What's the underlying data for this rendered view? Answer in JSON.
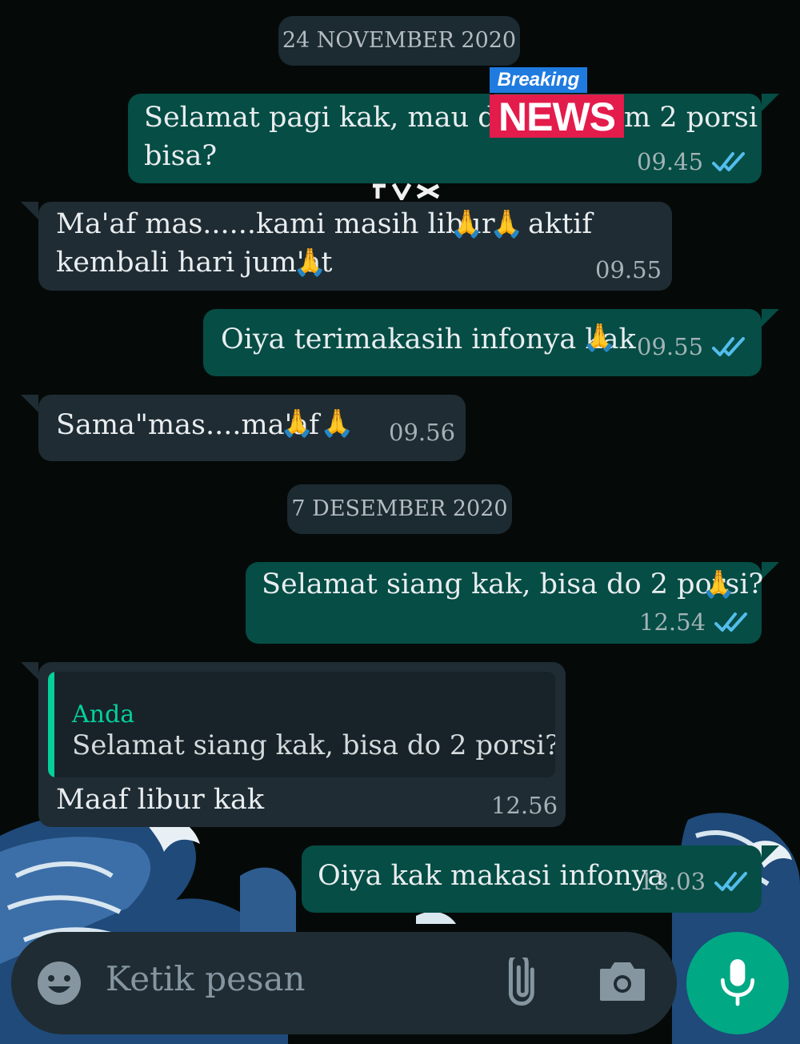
{
  "chat": {
    "date_1": "24 NOVEMBER 2020",
    "date_2": "7 DESEMBER 2020",
    "messages": [
      {
        "line1": "Selamat pagi kak, mau do m",
        "line1b": "m 2 porsi",
        "line2": "bisa?",
        "time": "09.45"
      },
      {
        "line1": "Ma'af mas......kami masih libur",
        "line1b": "aktif",
        "line2": "kembali hari jum'at",
        "time": "09.55"
      },
      {
        "text": "Oiya terimakasih infonya kak",
        "time": "09.55"
      },
      {
        "text": "Sama\"mas....ma'af",
        "time": "09.56"
      },
      {
        "text": "Selamat siang kak, bisa do 2 porsi?",
        "time": "12.54"
      },
      {
        "quote_name": "Anda",
        "quote_text": "Selamat siang kak, bisa do 2 porsi?",
        "text": "Maaf libur kak",
        "time": "12.56"
      },
      {
        "text": "Oiya kak makasi infonya",
        "time": "13.03"
      }
    ]
  },
  "overlay": {
    "breaking": "Breaking",
    "news": "NEWS"
  },
  "composer": {
    "placeholder": "Ketik pesan"
  },
  "icons": {
    "emoji": "emoji-icon",
    "attach": "paperclip-icon",
    "camera": "camera-icon",
    "mic": "mic-icon",
    "ticks": "double-check-icon",
    "pray": "🙏"
  },
  "colors": {
    "outgoing": "#054d45",
    "incoming": "#1f2c33",
    "accent": "#00a884",
    "read_ticks": "#53bdeb",
    "quote_name": "#06cf9c"
  }
}
